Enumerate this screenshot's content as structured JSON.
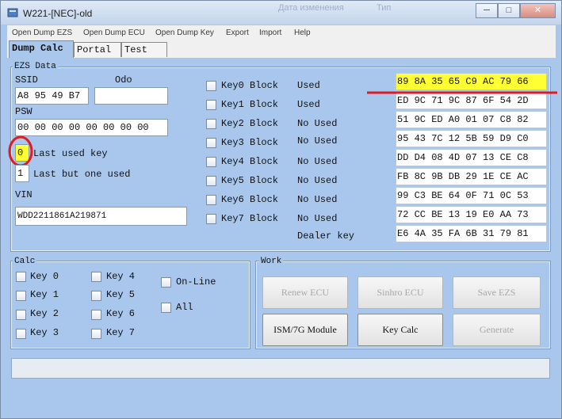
{
  "window": {
    "title": "W221-[NEC]-old",
    "faded_left": "Дата изменения",
    "faded_right": "Тип"
  },
  "menu": [
    "Open Dump EZS",
    "Open Dump ECU",
    "Open Dump Key",
    "Export",
    "Import",
    "Help"
  ],
  "tabs": [
    "Dump Calc",
    "Portal",
    "Test"
  ],
  "ezs": {
    "group_label": "EZS Data",
    "ssid_label": "SSID",
    "odo_label": "Odo",
    "ssid_value": "A8 95 49 B7",
    "odo_value": "",
    "psw_label": "PSW",
    "psw_value": "00 00 00 00 00 00 00 00",
    "last_used_value": "0",
    "last_used_label": "Last used key",
    "last_but_one_value": "1",
    "last_but_one_label": "Last but one used",
    "vin_label": "VIN",
    "vin_value": "WDD2211861A219871",
    "highlight_color": "#ffff33",
    "annotation_color": "#e01b24"
  },
  "keys": [
    {
      "label": "Key0 Block",
      "status": "Used",
      "hex": "89 8A 35 65 C9 AC 79 66"
    },
    {
      "label": "Key1 Block",
      "status": "Used",
      "hex": "ED 9C 71 9C 87 6F 54 2D"
    },
    {
      "label": "Key2 Block",
      "status": "No Used",
      "hex": "51 9C ED A0 01 07 C8 82"
    },
    {
      "label": "Key3 Block",
      "status": "No Used",
      "hex": "95 43 7C 12 5B 59 D9 C0"
    },
    {
      "label": "Key4 Block",
      "status": "No Used",
      "hex": "DD D4 08 4D 07 13 CE C8"
    },
    {
      "label": "Key5 Block",
      "status": "No Used",
      "hex": "FB 8C 9B DB 29 1E CE AC"
    },
    {
      "label": "Key6 Block",
      "status": "No Used",
      "hex": "99 C3 BE 64 0F 71 0C 53"
    },
    {
      "label": "Key7 Block",
      "status": "No Used",
      "hex": "72 CC BE 13 19 E0 AA 73"
    }
  ],
  "dealer": {
    "label": "Dealer key",
    "hex": "E6 4A 35 FA 6B 31 79 81"
  },
  "calc": {
    "group_label": "Calc",
    "keys": [
      "Key 0",
      "Key 1",
      "Key 2",
      "Key 3",
      "Key 4",
      "Key 5",
      "Key 6",
      "Key 7"
    ],
    "online": "On-Line",
    "all": "All"
  },
  "work": {
    "group_label": "Work",
    "renew": "Renew ECU",
    "sinhro": "Sinhro ECU",
    "save": "Save EZS",
    "ism": "ISM/7G Module",
    "keycalc": "Key Calc",
    "generate": "Generate"
  }
}
